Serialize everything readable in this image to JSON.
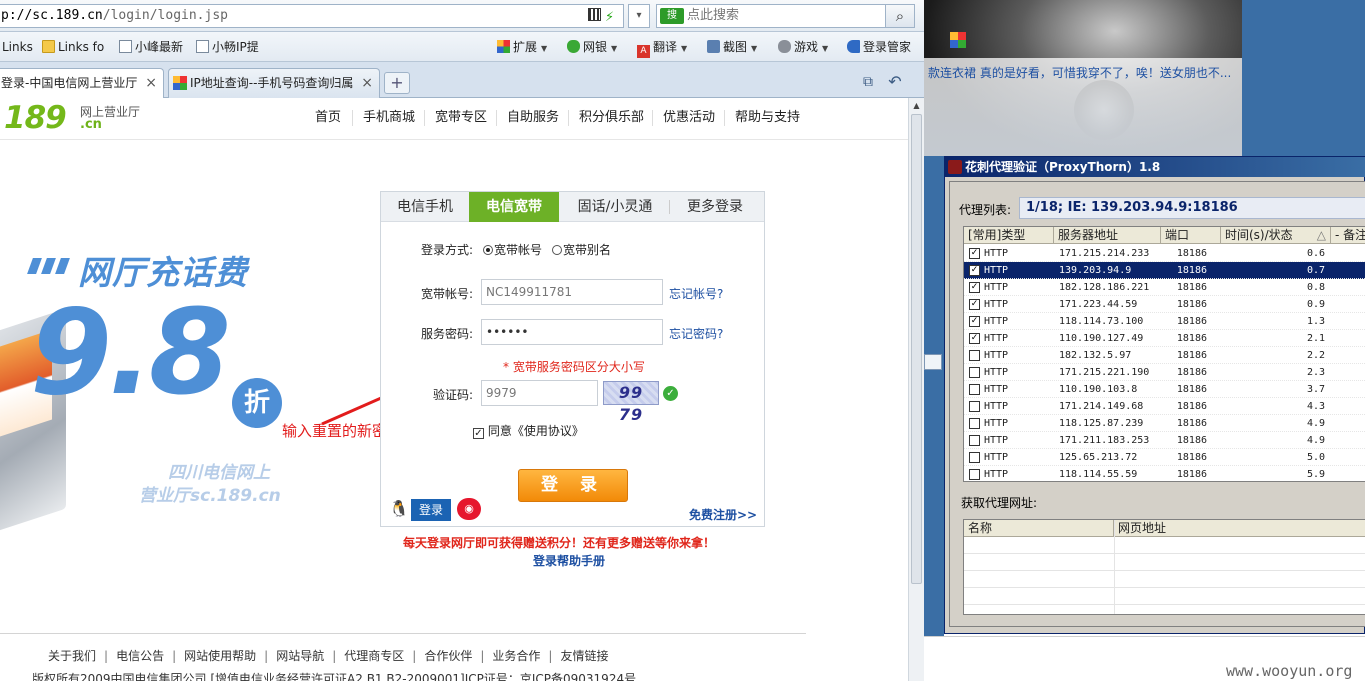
{
  "browser": {
    "url_host": "p://sc.189.cn",
    "url_path": "/login/login.jsp",
    "url_dropdown": "▾",
    "search_placeholder": "点此搜索",
    "search_engine": "搜",
    "search_icon": "search-icon",
    "favorites": [
      {
        "label": "Links",
        "icon": "link-icon"
      },
      {
        "label": "Links fo",
        "icon": "folder-icon"
      },
      {
        "label": "小峰最新",
        "icon": "page-icon"
      },
      {
        "label": "小畅IP提",
        "icon": "page-icon"
      }
    ],
    "toolbar": [
      {
        "label": "扩展",
        "icon": "apps-icon"
      },
      {
        "label": "网银",
        "icon": "shield-icon"
      },
      {
        "label": "翻译",
        "icon": "translate-icon"
      },
      {
        "label": "截图",
        "icon": "screenshot-icon"
      },
      {
        "label": "游戏",
        "icon": "gamepad-icon"
      },
      {
        "label": "登录管家",
        "icon": "key-icon"
      }
    ],
    "tabs": [
      {
        "label": "登录-中国电信网上营业厅",
        "active": true
      },
      {
        "label": "IP地址查询--手机号码查询归属",
        "active": false
      }
    ],
    "tab_close": "×",
    "new_tab": "+"
  },
  "site": {
    "logo_num": "189",
    "logo_sub": "网上营业厅",
    "logo_cn": ".cn",
    "nav": [
      "首页",
      "手机商城",
      "宽带专区",
      "自助服务",
      "积分俱乐部",
      "优惠活动",
      "帮助与支持"
    ]
  },
  "promo": {
    "title": "网厅充话费",
    "big": "9.8",
    "zhe": "折",
    "sub1": "四川电信网上",
    "sub2": "营业厅sc.189.cn"
  },
  "annotation": "输入重置的新密码",
  "login": {
    "tabs": [
      "电信手机",
      "电信宽带",
      "固话/小灵通",
      "更多登录"
    ],
    "active_tab": 1,
    "method_label": "登录方式:",
    "method_options": [
      "宽带帐号",
      "宽带别名"
    ],
    "account_label": "宽带帐号:",
    "account_value": "NC149911781",
    "forgot_account": "忘记帐号?",
    "password_label": "服务密码:",
    "password_value": "••••••",
    "forgot_password": "忘记密码?",
    "password_hint": "* 宽带服务密码区分大小写",
    "captcha_label": "验证码:",
    "captcha_value": "9979",
    "captcha_image_text": "99 79",
    "agree_text": "同意《使用协议》",
    "submit": "登 录",
    "qq_login": "登录",
    "weibo": "微博",
    "register": "免费注册>>"
  },
  "below_login": {
    "promo_text": "每天登录网厅即可获得赠送积分！还有更多赠送等你来拿！",
    "help_link": "登录帮助手册"
  },
  "footer": {
    "links": [
      "关于我们",
      "电信公告",
      "网站使用帮助",
      "网站导航",
      "代理商专区",
      "合作伙伴",
      "业务合作",
      "友情链接"
    ],
    "copyright": "版权所有2009中国电信集团公司 [增值电信业务经营许可证A2.B1.B2-2009001]ICP证号：京ICP备09031924号"
  },
  "desktop": {
    "weibo_text": "款连衣裙 真的是好看，可惜我穿不了，唉！送女朋也不...",
    "watermark": "www.wooyun.org"
  },
  "proxythorn": {
    "title": "花刺代理验证（ProxyThorn）1.8",
    "list_label": "代理列表:",
    "current": "1/18;    IE: 139.203.94.9:18186",
    "columns": [
      "[常用]类型",
      "服务器地址",
      "端口",
      "时间(s)/状态",
      "- 备注"
    ],
    "rows": [
      {
        "checked": true,
        "type": "HTTP",
        "ip": "171.215.214.233",
        "port": "18186",
        "time": "0.6",
        "selected": false
      },
      {
        "checked": true,
        "type": "HTTP",
        "ip": "139.203.94.9",
        "port": "18186",
        "time": "0.7",
        "selected": true
      },
      {
        "checked": true,
        "type": "HTTP",
        "ip": "182.128.186.221",
        "port": "18186",
        "time": "0.8",
        "selected": false
      },
      {
        "checked": true,
        "type": "HTTP",
        "ip": "171.223.44.59",
        "port": "18186",
        "time": "0.9",
        "selected": false
      },
      {
        "checked": true,
        "type": "HTTP",
        "ip": "118.114.73.100",
        "port": "18186",
        "time": "1.3",
        "selected": false
      },
      {
        "checked": true,
        "type": "HTTP",
        "ip": "110.190.127.49",
        "port": "18186",
        "time": "2.1",
        "selected": false
      },
      {
        "checked": false,
        "type": "HTTP",
        "ip": "182.132.5.97",
        "port": "18186",
        "time": "2.2",
        "selected": false
      },
      {
        "checked": false,
        "type": "HTTP",
        "ip": "171.215.221.190",
        "port": "18186",
        "time": "2.3",
        "selected": false
      },
      {
        "checked": false,
        "type": "HTTP",
        "ip": "110.190.103.8",
        "port": "18186",
        "time": "3.7",
        "selected": false
      },
      {
        "checked": false,
        "type": "HTTP",
        "ip": "171.214.149.68",
        "port": "18186",
        "time": "4.3",
        "selected": false
      },
      {
        "checked": false,
        "type": "HTTP",
        "ip": "118.125.87.239",
        "port": "18186",
        "time": "4.9",
        "selected": false
      },
      {
        "checked": false,
        "type": "HTTP",
        "ip": "171.211.183.253",
        "port": "18186",
        "time": "4.9",
        "selected": false
      },
      {
        "checked": false,
        "type": "HTTP",
        "ip": "125.65.213.72",
        "port": "18186",
        "time": "5.0",
        "selected": false
      },
      {
        "checked": false,
        "type": "HTTP",
        "ip": "118.114.55.59",
        "port": "18186",
        "time": "5.9",
        "selected": false
      }
    ],
    "fetch_label": "获取代理网址:",
    "url_columns": [
      "名称",
      "网页地址"
    ]
  },
  "colors": {
    "accent_green": "#6db127",
    "link_blue": "#1e50a2",
    "alert_red": "#e0261b",
    "promo_blue": "#4e8fd6",
    "login_orange": "#f28a08",
    "selection_navy": "#0a246a"
  }
}
